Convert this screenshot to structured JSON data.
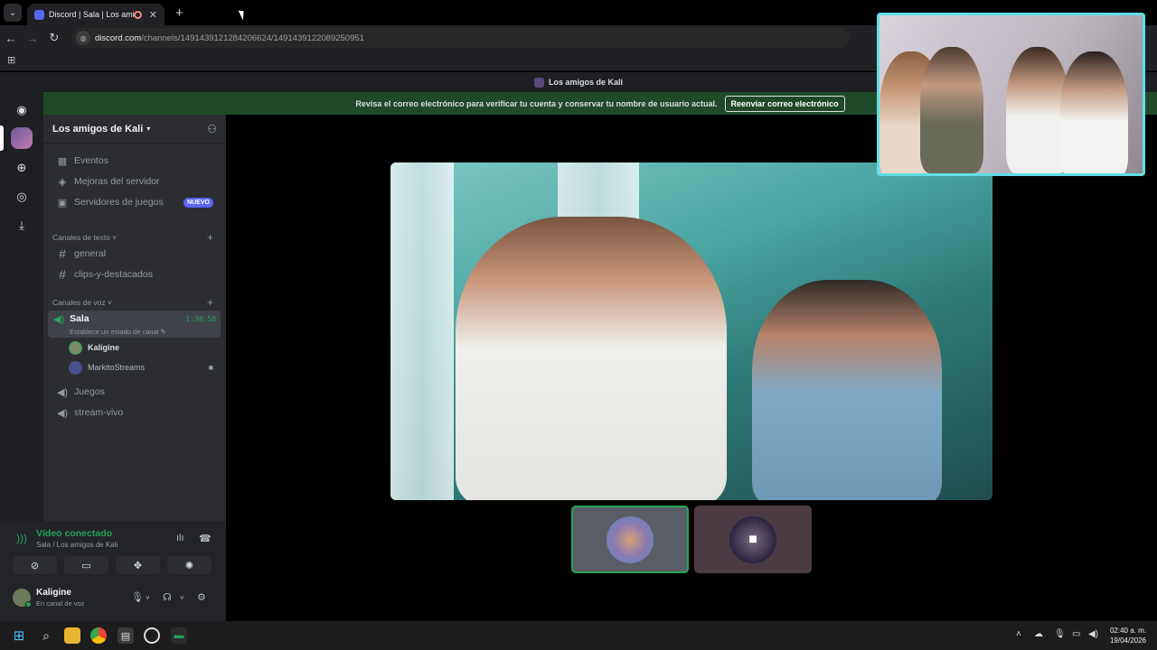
{
  "browser": {
    "tab_title": "Discord | Sala | Los amigos de Kali",
    "url_host": "discord.com",
    "url_path": "/channels/1491439121284206624/1491439122089250951"
  },
  "discord": {
    "window_title": "Los amigos de Kali",
    "banner_text": "Revisa el correo electrónico para verificar tu cuenta y conservar tu nombre de usuario actual.",
    "banner_button": "Reenviar correo electrónico",
    "server_name": "Los amigos de Kali",
    "menu": [
      {
        "label": "Eventos",
        "icon": "calendar-icon"
      },
      {
        "label": "Mejoras del servidor",
        "icon": "boost-icon"
      },
      {
        "label": "Servidores de juegos",
        "icon": "gamepad-icon",
        "badge": "NUEVO"
      }
    ],
    "text_category": "Canales de texto",
    "text_channels": [
      "general",
      "clips-y-destacados"
    ],
    "voice_category": "Canales de voz",
    "active_voice": {
      "name": "Sala",
      "timer": "1:38:58",
      "status": "Establece un estado de canal"
    },
    "voice_users": [
      "Kaligine",
      "MarkitoStreams"
    ],
    "other_voice": [
      "Juegos",
      "stream-vivo"
    ],
    "connection": {
      "title": "Vídeo conectado",
      "subtitle": "Sala / Los amigos de Kali"
    },
    "user": {
      "name": "Kaligine",
      "status": "En canal de voz"
    }
  },
  "taskbar": {
    "time": "02:40 a. m.",
    "date": "19/04/2026"
  },
  "colors": {
    "accent": "#5865f2",
    "green": "#23a55a",
    "banner": "#1f4a2a",
    "pip_border": "#5fe0e6"
  }
}
